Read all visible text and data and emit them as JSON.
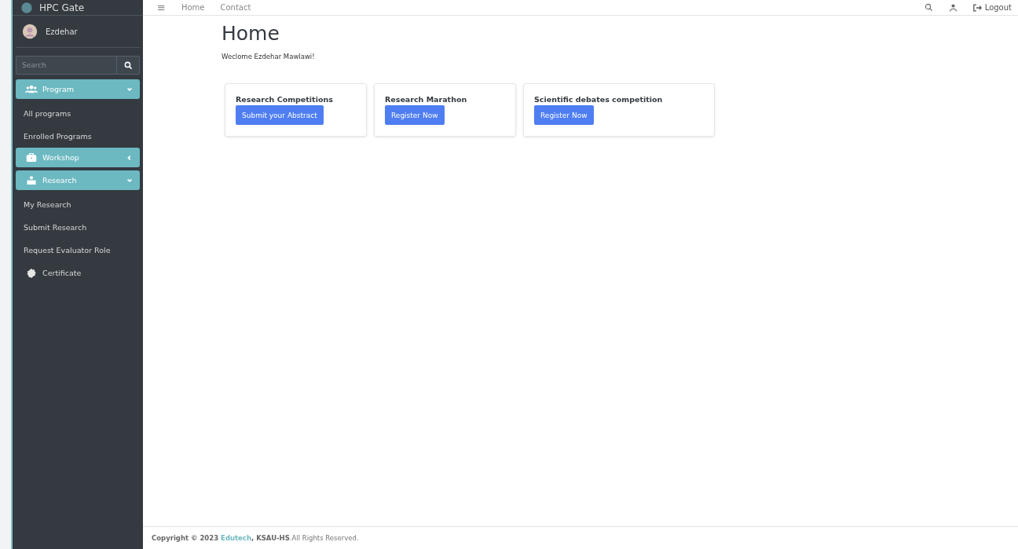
{
  "brand": {
    "title": "HPC Gate"
  },
  "user": {
    "name": "Ezdehar"
  },
  "sidebar_search": {
    "placeholder": "Search"
  },
  "sidebar": {
    "items": [
      {
        "kind": "group",
        "label": "Program",
        "expanded": true
      },
      {
        "kind": "link",
        "label": "All programs"
      },
      {
        "kind": "link",
        "label": "Enrolled Programs"
      },
      {
        "kind": "group",
        "label": "Workshop",
        "expanded": false
      },
      {
        "kind": "group",
        "label": "Research",
        "expanded": true
      },
      {
        "kind": "link",
        "label": "My Research"
      },
      {
        "kind": "link",
        "label": "Submit Research"
      },
      {
        "kind": "link",
        "label": "Request Evaluator Role"
      },
      {
        "kind": "iconlink",
        "label": "Certificate"
      }
    ]
  },
  "navbar": {
    "menu_icon": "≡",
    "links": [
      "Home",
      "Contact"
    ],
    "logout": "Logout"
  },
  "page": {
    "title": "Home",
    "welcome": "Weclome Ezdehar Mawlawi!"
  },
  "cards": [
    {
      "title": "Research Competitions",
      "button": "Submit your Abstract"
    },
    {
      "title": "Research Marathon",
      "button": "Register Now"
    },
    {
      "title": "Scientific debates competition",
      "button": "Register Now"
    }
  ],
  "footer": {
    "copyright": "Copyright © 2023",
    "link": "Edutech",
    "org": ", KSAU-HS",
    "rights": ".All Rights Reserved."
  }
}
